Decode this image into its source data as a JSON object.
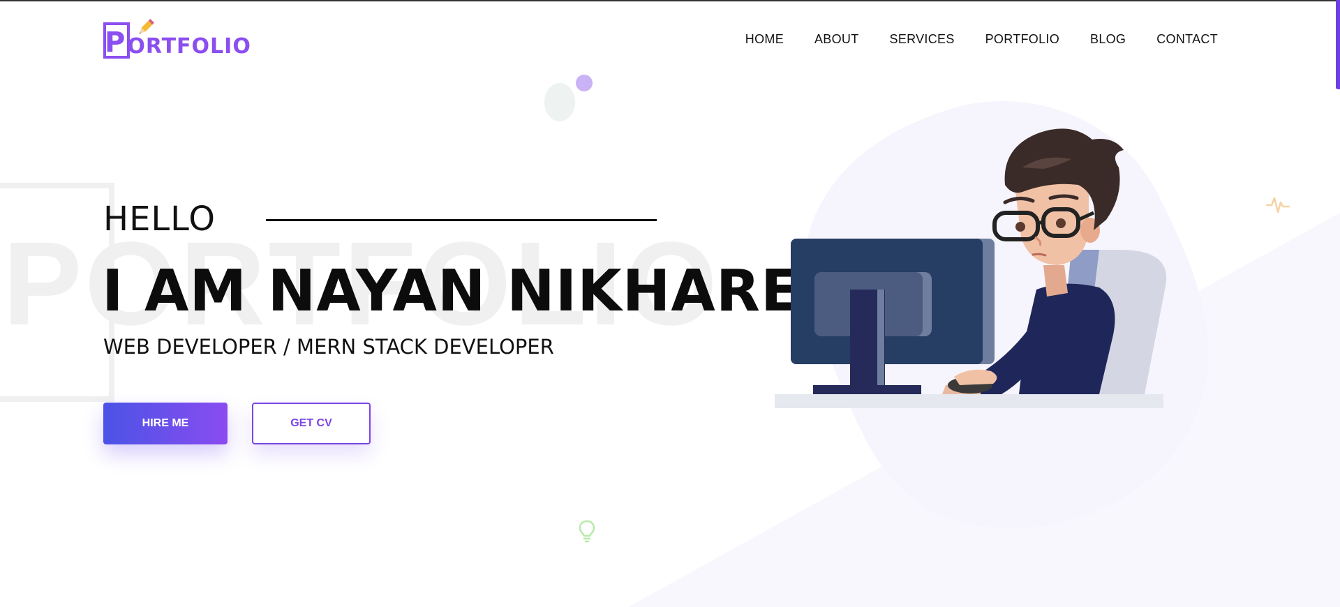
{
  "header": {
    "logo_text": "PORTFOLIO",
    "nav": [
      {
        "label": "HOME"
      },
      {
        "label": "ABOUT"
      },
      {
        "label": "SERVICES"
      },
      {
        "label": "PORTFOLIO"
      },
      {
        "label": "BLOG"
      },
      {
        "label": "CONTACT"
      }
    ]
  },
  "hero": {
    "watermark": "PORTFOLIO",
    "greeting": "HELLO",
    "name": "I AM NAYAN NIKHARE",
    "role": "WEB DEVELOPER / MERN STACK DEVELOPER",
    "hire_button": "HIRE ME",
    "cv_button": "GET CV"
  },
  "colors": {
    "accent": "#8b4ef0",
    "button_gradient_start": "#4b53e6",
    "button_gradient_end": "#8a4cf0"
  },
  "icons": [
    "pencil-icon",
    "pulse-icon",
    "lightbulb-icon"
  ]
}
